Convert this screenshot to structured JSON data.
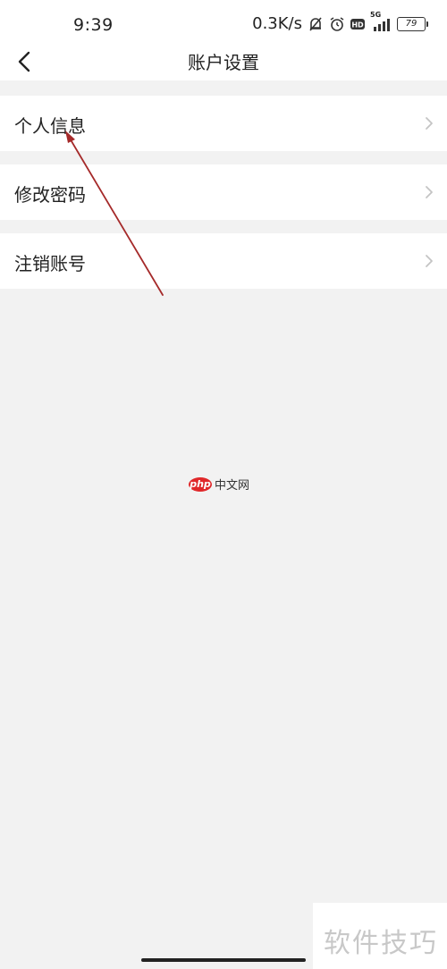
{
  "status_bar": {
    "time": "9:39",
    "network_speed": "0.3K/s",
    "signal_label": "5G",
    "battery_level": "79"
  },
  "nav": {
    "title": "账户设置"
  },
  "menu": {
    "items": [
      {
        "label": "个人信息"
      },
      {
        "label": "修改密码"
      },
      {
        "label": "注销账号"
      }
    ]
  },
  "watermarks": {
    "php_logo": "php",
    "php_text": "中文网",
    "bottom_text": "软件技巧"
  },
  "colors": {
    "background": "#f2f2f2",
    "row_background": "#ffffff",
    "annotation_arrow": "#a52a2a",
    "php_brand": "#e0282a"
  }
}
